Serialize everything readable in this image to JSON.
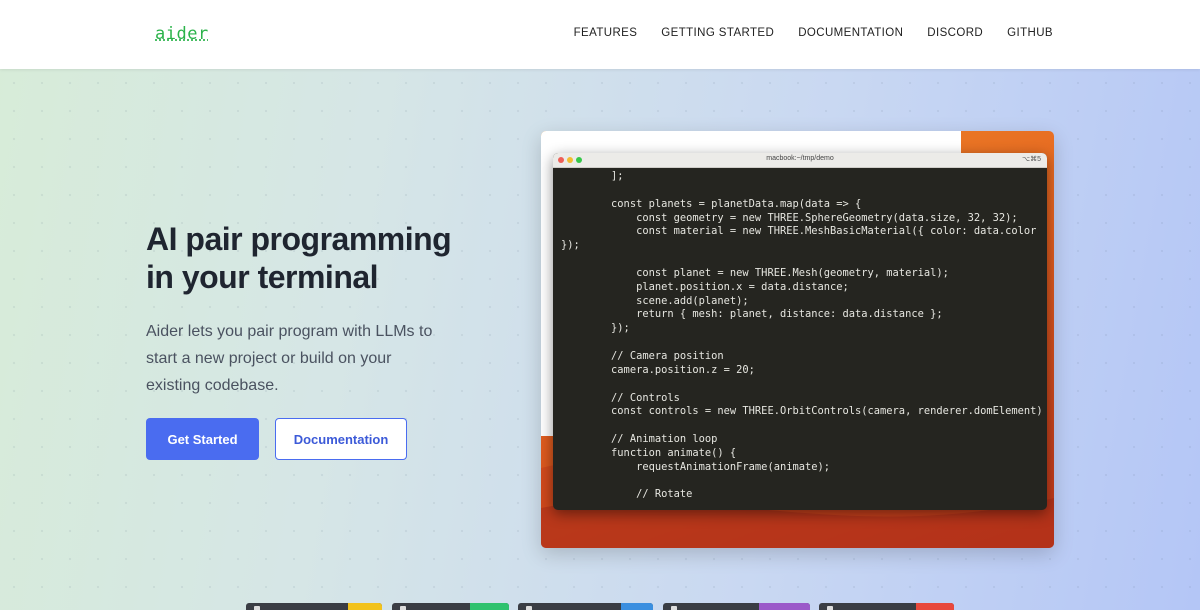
{
  "header": {
    "logo": "aider",
    "nav": [
      "FEATURES",
      "GETTING STARTED",
      "DOCUMENTATION",
      "DISCORD",
      "GITHUB"
    ]
  },
  "hero": {
    "title_line1": "AI pair programming",
    "title_line2": "in your terminal",
    "description": "Aider lets you pair program with LLMs to start a new project or build on your existing codebase.",
    "primary_button": "Get Started",
    "secondary_button": "Documentation"
  },
  "terminal": {
    "window_title": "macbook:~/tmp/demo",
    "shortcut": "⌥⌘5",
    "code_lines": [
      "        ];",
      "",
      "        const planets = planetData.map(data => {",
      "            const geometry = new THREE.SphereGeometry(data.size, 32, 32);",
      "            const material = new THREE.MeshBasicMaterial({ color: data.color",
      "});",
      "",
      "            const planet = new THREE.Mesh(geometry, material);",
      "            planet.position.x = data.distance;",
      "            scene.add(planet);",
      "            return { mesh: planet, distance: data.distance };",
      "        });",
      "",
      "        // Camera position",
      "        camera.position.z = 20;",
      "",
      "        // Controls",
      "        const controls = new THREE.OrbitControls(camera, renderer.domElement)",
      "",
      "        // Animation loop",
      "        function animate() {",
      "            requestAnimationFrame(animate);",
      "",
      "            // Rotate"
    ]
  },
  "colors": {
    "logo": "#2bb34a",
    "primary": "#4a6cf0",
    "title": "#1f2530",
    "terminal_bg": "#252520"
  },
  "bottom_cards": {
    "accent_colors": [
      "#f2c21b",
      "#2fc26e",
      "#3b8fe0",
      "#9b59c9",
      "#e8483c"
    ]
  }
}
